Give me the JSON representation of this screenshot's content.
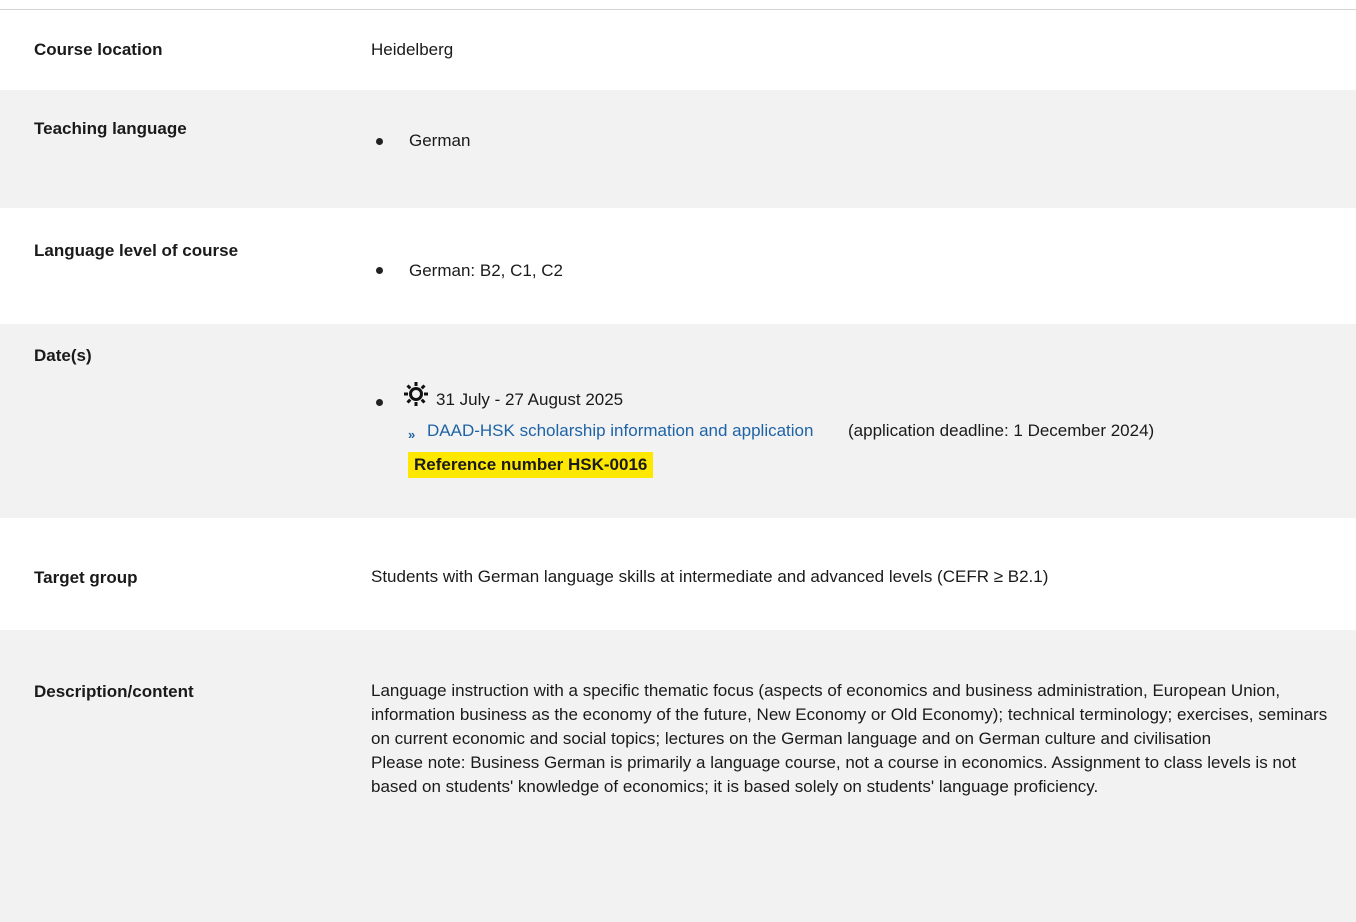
{
  "rows": {
    "location": {
      "label": "Course location",
      "value": "Heidelberg"
    },
    "teaching_language": {
      "label": "Teaching language",
      "items": [
        "German"
      ]
    },
    "language_level": {
      "label": "Language level of course",
      "items": [
        "German: B2, C1, C2"
      ]
    },
    "dates": {
      "label": "Date(s)",
      "date_text": "31 July - 27 August 2025",
      "date_icon": "sun-icon",
      "link_icon": "double-chevron-icon",
      "link_text": "DAAD-HSK scholarship information and application",
      "link_note": "(application deadline: 1 December 2024)",
      "reference": "Reference number HSK-0016",
      "reference_color": "#ffe800"
    },
    "target_group": {
      "label": "Target group",
      "value": "Students with German language skills at intermediate and advanced levels (CEFR ≥ B2.1)"
    },
    "description": {
      "label": "Description/content",
      "paragraph1": "Language instruction with a specific thematic focus (aspects of economics and business administration, European Union, information business as the economy of the future, New Economy or Old Economy); technical terminology; exercises, seminars on current economic and social topics; lectures on the German language and on German culture and civilisation",
      "paragraph2": "Please note: Business German is primarily a language course, not a course in economics. Assignment to class levels is not based on students' knowledge of economics; it is based solely on students' language proficiency."
    }
  },
  "colors": {
    "shade": "#f2f2f2",
    "link": "#1e63a6",
    "highlight": "#ffe800"
  }
}
